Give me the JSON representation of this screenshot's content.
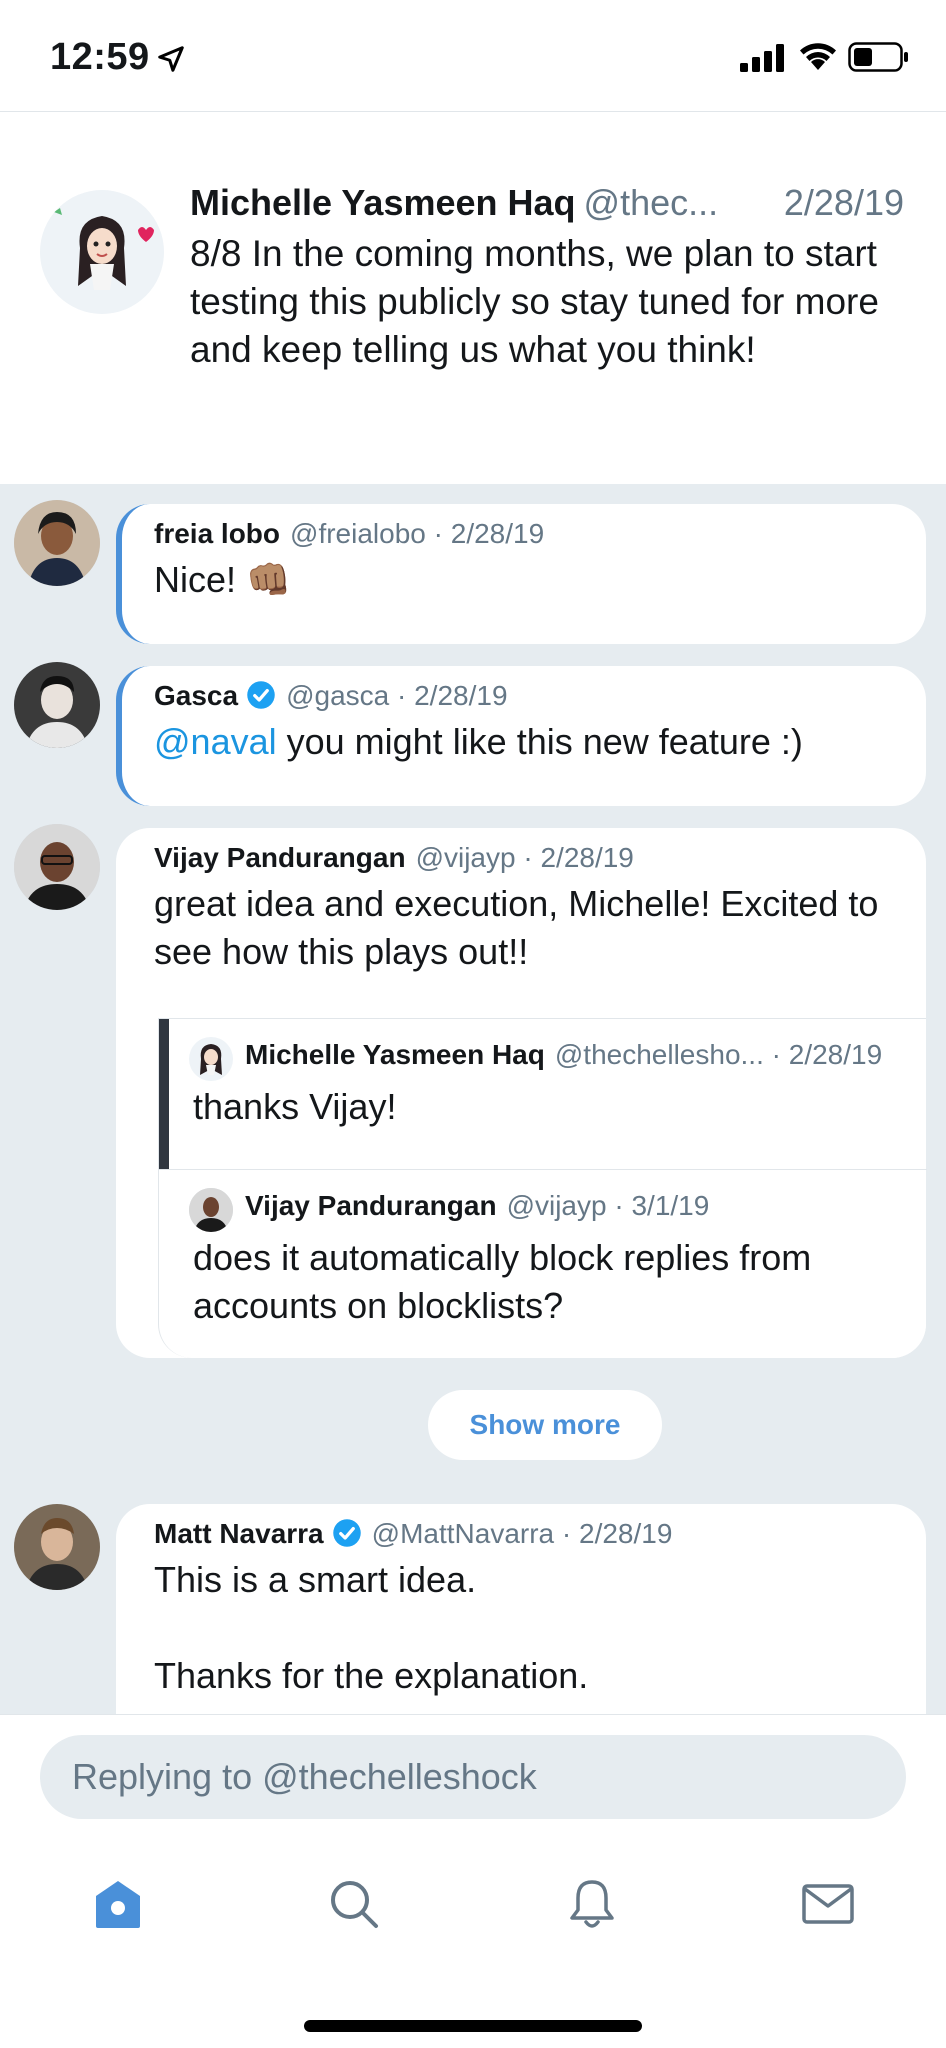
{
  "status_bar": {
    "time": "12:59"
  },
  "main_tweet": {
    "name": "Michelle Yasmeen Haq",
    "handle": "@thec...",
    "date": "2/28/19",
    "text": "8/8 In the coming months, we plan to start testing this publicly so stay tuned for more and keep telling us what you think!"
  },
  "replies": [
    {
      "name": "freia lobo",
      "handle": "@freialobo",
      "date": "· 2/28/19",
      "text": "Nice! 👊🏽"
    },
    {
      "name": "Gasca",
      "handle": "@gasca",
      "date": "· 2/28/19",
      "mention": "@naval",
      "text": " you might like this new feature :)"
    },
    {
      "name": "Vijay Pandurangan",
      "handle": "@vijayp",
      "date": "· 2/28/19",
      "text": "great idea and execution, Michelle! Excited to see how this plays out!!"
    },
    {
      "name": "Matt Navarra",
      "handle": "@MattNavarra",
      "date": "· 2/28/19",
      "text": "This is a smart idea.",
      "text2": "Thanks for the explanation."
    }
  ],
  "nested_replies": [
    {
      "name": "Michelle Yasmeen Haq",
      "handle": "@thechellesho...",
      "date": "· 2/28/19",
      "text": "thanks Vijay!"
    },
    {
      "name": "Vijay Pandurangan",
      "handle": "@vijayp",
      "date": "· 3/1/19",
      "text": "does it automatically block replies from accounts on blocklists?"
    }
  ],
  "show_more_label": "Show more",
  "reply_bar": {
    "placeholder": "Replying to @thechelleshock"
  },
  "tabs": [
    {
      "icon": "home-icon",
      "active": true
    },
    {
      "icon": "search-icon",
      "active": false
    },
    {
      "icon": "bell-icon",
      "active": false
    },
    {
      "icon": "mail-icon",
      "active": false
    }
  ],
  "colors": {
    "accent": "#4a90d9",
    "link": "#1b95e0",
    "secondary_text": "#657786",
    "background": "#e6ecf0"
  }
}
